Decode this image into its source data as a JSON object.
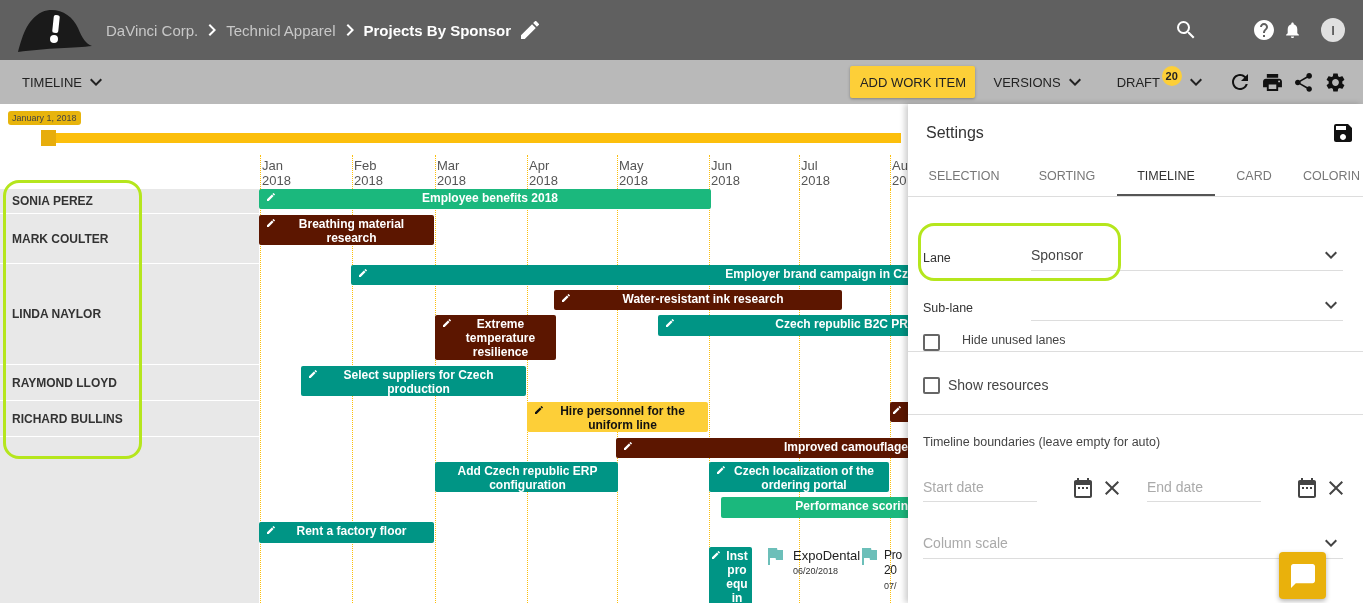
{
  "header": {
    "breadcrumbs": [
      {
        "label": "DaVinci Corp.",
        "current": false
      },
      {
        "label": "Technicl Apparel",
        "current": false
      },
      {
        "label": "Projects By Sponsor",
        "current": true
      }
    ],
    "avatar": "I"
  },
  "toolbar": {
    "view": "TIMELINE",
    "add_button": "ADD WORK ITEM",
    "versions": "VERSIONS",
    "draft": "DRAFT",
    "draft_count": "20"
  },
  "range_slider": {
    "label": "January 1, 2018",
    "level": 0
  },
  "months": [
    {
      "month": "Jan",
      "year": "2018"
    },
    {
      "month": "Feb",
      "year": "2018"
    },
    {
      "month": "Mar",
      "year": "2018"
    },
    {
      "month": "Apr",
      "year": "2018"
    },
    {
      "month": "May",
      "year": "2018"
    },
    {
      "month": "Jun",
      "year": "2018"
    },
    {
      "month": "Jul",
      "year": "2018"
    },
    {
      "month": "Au",
      "year": "20"
    }
  ],
  "lanes": [
    {
      "name": "SONIA PEREZ"
    },
    {
      "name": "MARK COULTER"
    },
    {
      "name": "LINDA NAYLOR"
    },
    {
      "name": "RAYMOND LLOYD"
    },
    {
      "name": "RICHARD BULLINS"
    }
  ],
  "bars": [
    {
      "title": "Employee benefits 2018",
      "color": "#1bb87d",
      "editable": true
    },
    {
      "title": "Breathing material research",
      "color": "#5c1600",
      "editable": true
    },
    {
      "title": "Employer brand campaign in Cz",
      "color": "#009585",
      "editable": true
    },
    {
      "title": "Water-resistant ink research",
      "color": "#5c1600",
      "editable": true
    },
    {
      "title": "Extreme temperature resilience",
      "color": "#5c1600",
      "editable": true
    },
    {
      "title": "Czech republic B2C PR",
      "color": "#009585",
      "editable": true
    },
    {
      "title": "Select suppliers for Czech production",
      "color": "#009585",
      "editable": true
    },
    {
      "title": "Hire personnel for the uniform line",
      "color": "#fdcf38",
      "editable": true
    },
    {
      "color": "#5c1600",
      "editable": true
    },
    {
      "title": "Improved camouflage",
      "color": "#5c1600",
      "editable": true
    },
    {
      "title": "Add Czech republic ERP configuration",
      "color": "#009585",
      "editable": false
    },
    {
      "title": "Czech localization of the ordering portal",
      "color": "#009585",
      "editable": true
    },
    {
      "title": "Performance scorin",
      "color": "#1bb87d",
      "editable": false
    },
    {
      "title": "Rent a factory floor",
      "color": "#009585",
      "editable": true
    },
    {
      "title": "Inst pro equ in",
      "color": "#009585",
      "editable": true
    }
  ],
  "milestones": [
    {
      "title": "ExpoDental",
      "date": "06/20/2018"
    },
    {
      "title": "Pro 20",
      "date": "07/"
    }
  ],
  "settings": {
    "title": "Settings",
    "tabs": [
      {
        "label": "SELECTION",
        "selected": false
      },
      {
        "label": "SORTING",
        "selected": false
      },
      {
        "label": "TIMELINE",
        "selected": true
      },
      {
        "label": "CARD",
        "selected": false
      },
      {
        "label": "COLORIN",
        "selected": false
      }
    ],
    "sections": [
      {
        "fields": [
          {
            "kind": "select",
            "label": "Lane",
            "value": "Sponsor"
          },
          {
            "kind": "select",
            "label": "Sub-lane"
          },
          {
            "kind": "checkbox",
            "label": "Hide unused lanes",
            "checked": false
          }
        ]
      },
      {
        "fields": [
          {
            "kind": "checkbox",
            "label": "Show resources",
            "checked": false
          }
        ]
      },
      {
        "heading": "Timeline boundaries (leave empty for auto)",
        "fields": [
          {
            "kind": "date_range",
            "start": "Start date",
            "end": "End date"
          },
          {
            "kind": "select",
            "placeholder": "Column scale"
          }
        ]
      }
    ]
  }
}
